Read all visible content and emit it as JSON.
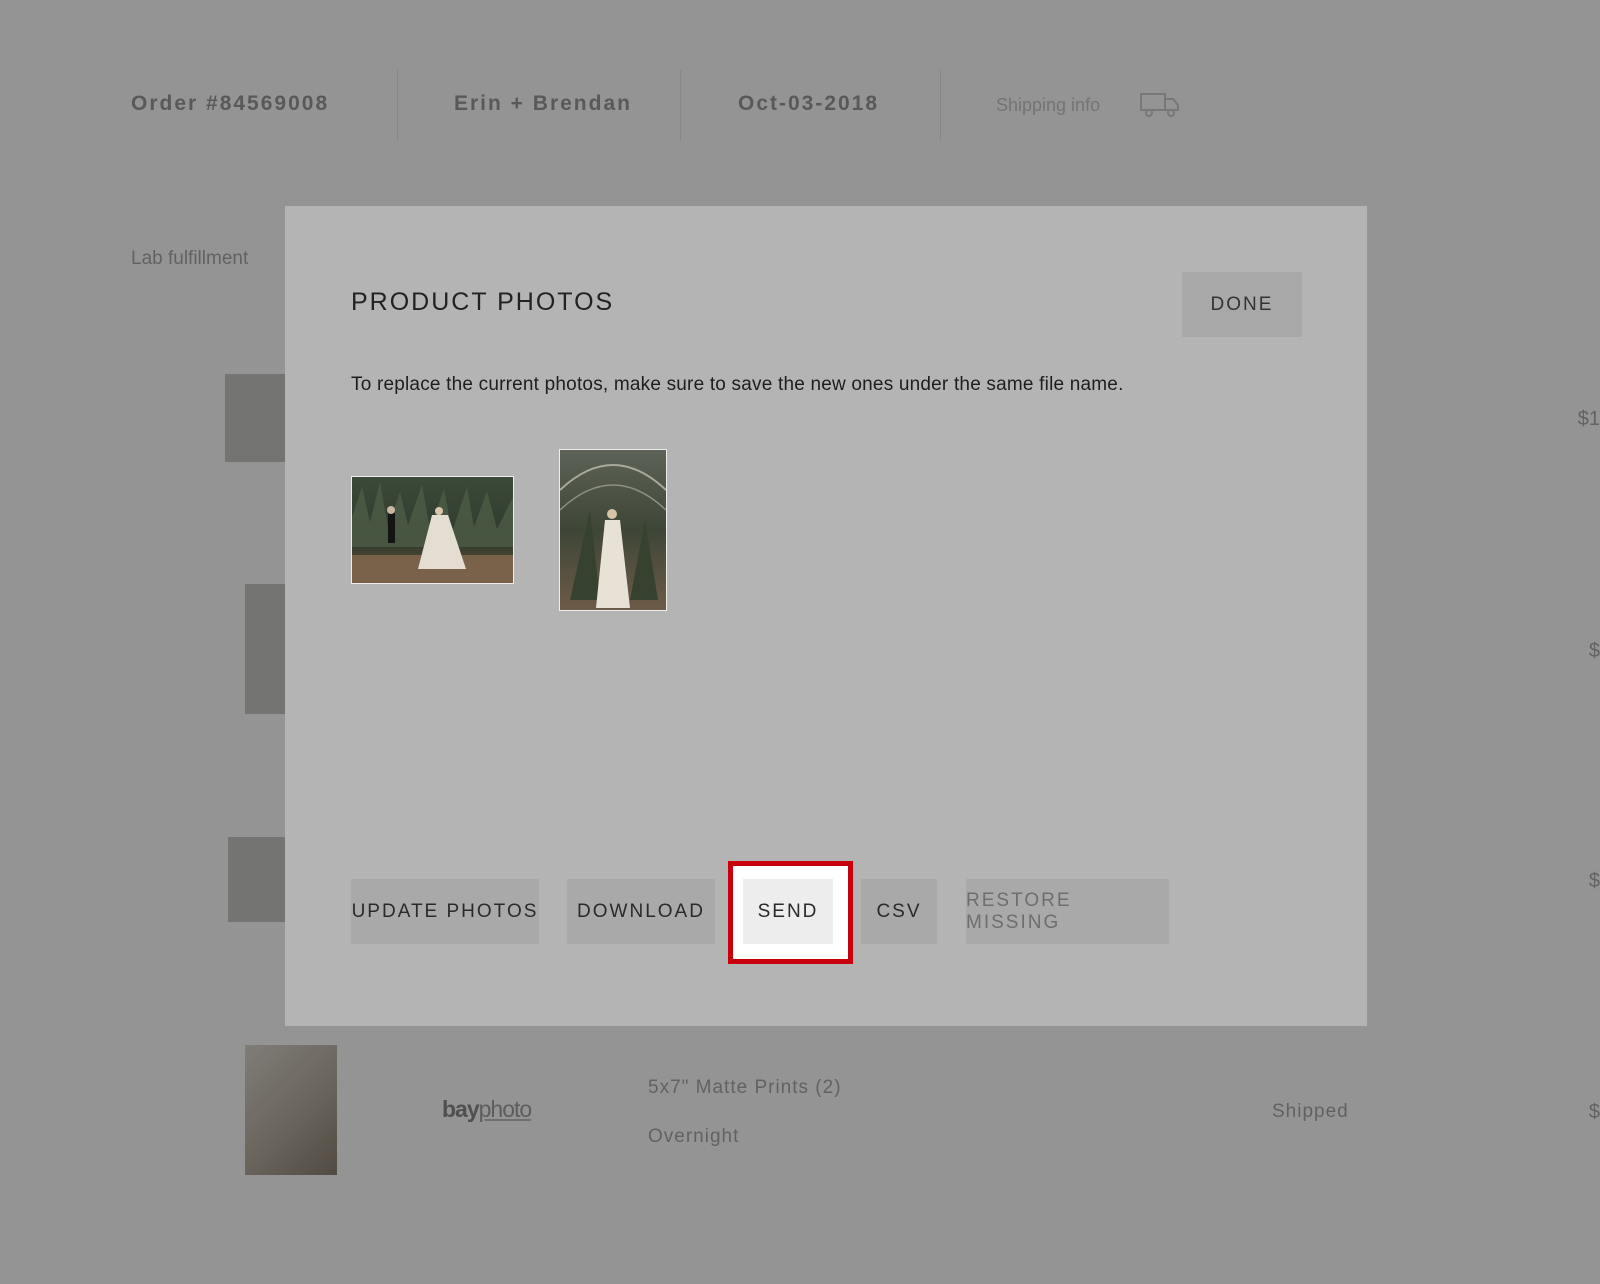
{
  "header": {
    "order": "Order #84569008",
    "client": "Erin + Brendan",
    "date": "Oct-03-2018",
    "shipping_info": "Shipping info",
    "shipping_icon": "truck-icon"
  },
  "background": {
    "section_label": "Lab fulfillment",
    "prices": [
      "$1",
      "$",
      "$",
      "$"
    ],
    "vendor_logo": {
      "part1": "bay",
      "part2": "photo"
    },
    "product_name": "5x7\" Matte Prints (2)",
    "shipping_method": "Overnight",
    "status": "Shipped"
  },
  "modal": {
    "title": "PRODUCT PHOTOS",
    "done_label": "DONE",
    "description": "To replace the current photos, make sure to save the new ones under the same file name.",
    "photos": [
      {
        "name": "couple-dancing-photo",
        "orientation": "landscape"
      },
      {
        "name": "bride-greenhouse-photo",
        "orientation": "portrait"
      }
    ],
    "buttons": {
      "update_photos": "UPDATE PHOTOS",
      "download": "DOWNLOAD",
      "send": "SEND",
      "csv": "CSV",
      "restore_missing": "RESTORE MISSING"
    }
  },
  "colors": {
    "highlight": "#c8000b",
    "modal_bg": "#b4b4b4",
    "button_bg": "#a9a9a9"
  }
}
